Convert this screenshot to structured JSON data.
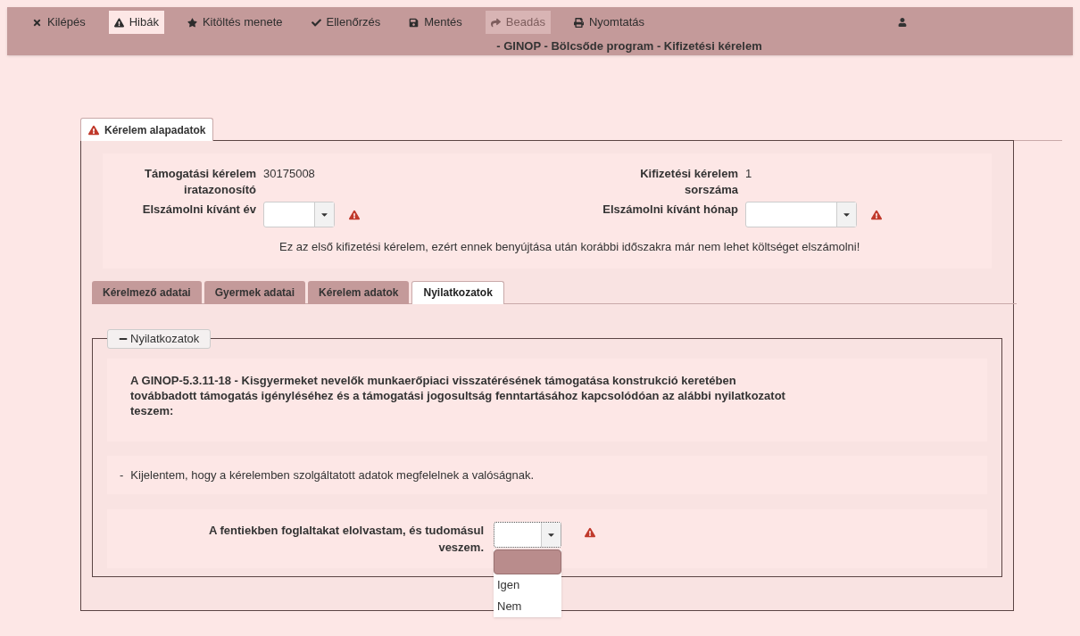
{
  "toolbar": {
    "items": [
      {
        "kind": "close",
        "label": "Kilépés",
        "selected": false,
        "disabled": false
      },
      {
        "kind": "warning",
        "label": "Hibák",
        "selected": true,
        "disabled": false
      },
      {
        "kind": "star",
        "label": "Kitöltés menete",
        "selected": false,
        "disabled": false
      },
      {
        "kind": "check",
        "label": "Ellenőrzés",
        "selected": false,
        "disabled": false
      },
      {
        "kind": "save",
        "label": "Mentés",
        "selected": false,
        "disabled": false
      },
      {
        "kind": "submit",
        "label": "Beadás",
        "selected": false,
        "disabled": true
      },
      {
        "kind": "print",
        "label": "Nyomtatás",
        "selected": false,
        "disabled": false
      }
    ],
    "title": "- GINOP - Bölcsőde program - Kifizetési kérelem"
  },
  "main_tab": {
    "label": "Kérelem alapadatok",
    "warning": true
  },
  "basic": {
    "fields": [
      {
        "kind": "text",
        "label": "Támogatási kérelem iratazonosító",
        "value": "30175008"
      },
      {
        "kind": "text",
        "label": "Kifizetési kérelem sorszáma",
        "value": "1"
      },
      {
        "kind": "select",
        "label": "Elszámolni kívánt év",
        "warning": true
      },
      {
        "kind": "select",
        "label": "Elszámolni kívánt hónap",
        "warning": true
      }
    ],
    "notice": "Ez az első kifizetési kérelem, ezért ennek benyújtása után korábbi időszakra már nem lehet költséget elszámolni!"
  },
  "sub_tabs": [
    {
      "label": "Kérelmező adatai",
      "selected": false
    },
    {
      "label": "Gyermek adatai",
      "selected": false
    },
    {
      "label": "Kérelem adatok",
      "selected": false
    },
    {
      "label": "Nyilatkozatok",
      "selected": true
    }
  ],
  "section": {
    "legend": "Nyilatkozatok",
    "expanded": true,
    "intro": "A GINOP-5.3.11-18 - Kisgyermeket nevelők munkaerőpiaci visszatérésének támogatása konstrukció keretében továbbadott támogatás igényléséhez és a támogatási jogosultság fenntartásához kapcsolódóan az alábbi nyilatkozatot teszem:",
    "statement": {
      "bullet": "-",
      "text": "Kijelentem, hogy a kérelemben szolgáltatott adatok megfelelnek a valóságnak."
    },
    "acknowledge": {
      "label": "A fentiekben foglaltakat elolvastam, és tudomásul veszem.",
      "warning": true,
      "open": true,
      "options": [
        "Igen",
        "Nem"
      ]
    }
  }
}
